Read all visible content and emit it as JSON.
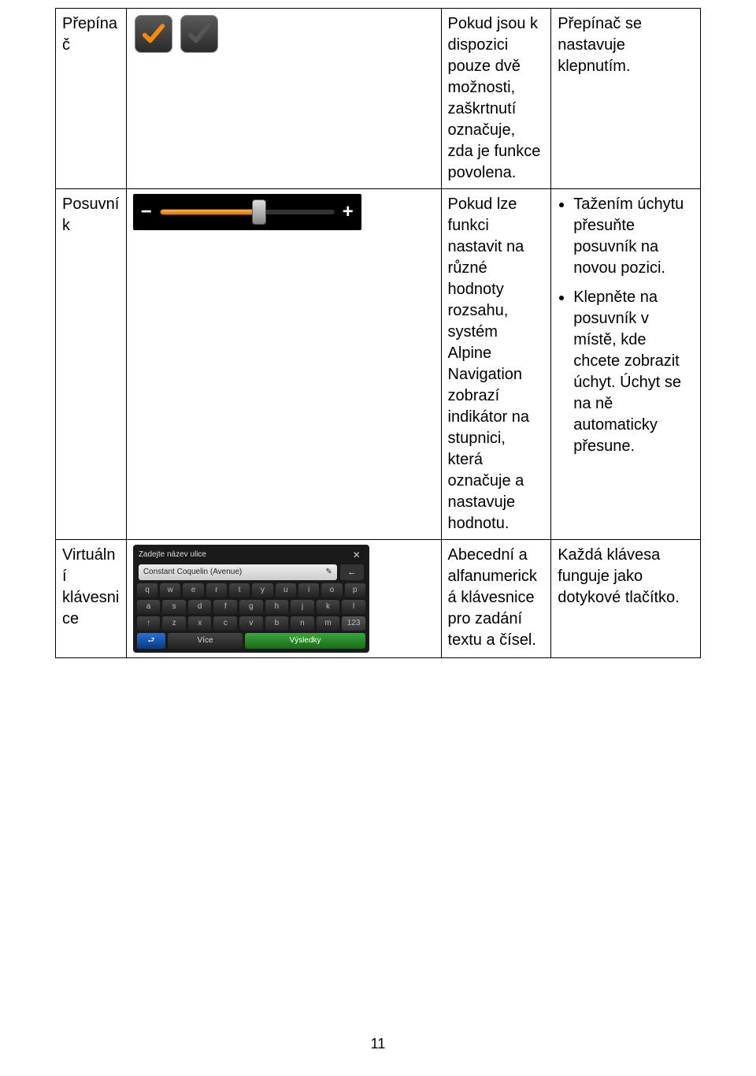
{
  "rows": {
    "r1": {
      "name": "Přepínač",
      "desc": "Pokud jsou k dispozici pouze dvě možnosti, zaškrtnutí označuje, zda je funkce povolena.",
      "action": "Přepínač se nastavuje klepnutím."
    },
    "r2": {
      "name": "Posuvník",
      "desc": "Pokud lze funkci nastavit na různé hodnoty rozsahu, systém Alpine Navigation zobrazí indikátor na stupnici, která označuje a nastavuje hodnotu.",
      "bullets": [
        "Tažením úchytu přesuňte posuvník na novou pozici.",
        "Klepněte na posuvník v místě, kde chcete zobrazit úchyt. Úchyt se na ně automaticky přesune."
      ]
    },
    "r3": {
      "name": "Virtuální klávesnice",
      "desc": "Abecední a alfanumerická klávesnice pro zadání textu a čísel.",
      "action": "Každá klávesa funguje jako dotykové tlačítko."
    }
  },
  "slider": {
    "minus": "−",
    "plus": "+"
  },
  "keyboard": {
    "prompt": "Zadejte název ulice",
    "field": "Constant Coquelin (Avenue)",
    "row_q": [
      "q",
      "w",
      "e",
      "r",
      "t",
      "y",
      "u",
      "i",
      "o",
      "p"
    ],
    "row_a": [
      "a",
      "s",
      "d",
      "f",
      "g",
      "h",
      "j",
      "k",
      "l"
    ],
    "row_z": [
      "z",
      "x",
      "c",
      "v",
      "b",
      "n",
      "m"
    ],
    "num_key": "123",
    "shift": "↑",
    "back_arrow": "←",
    "return": "⮐",
    "more": "Více",
    "results": "Výsledky"
  },
  "page_number": "11"
}
